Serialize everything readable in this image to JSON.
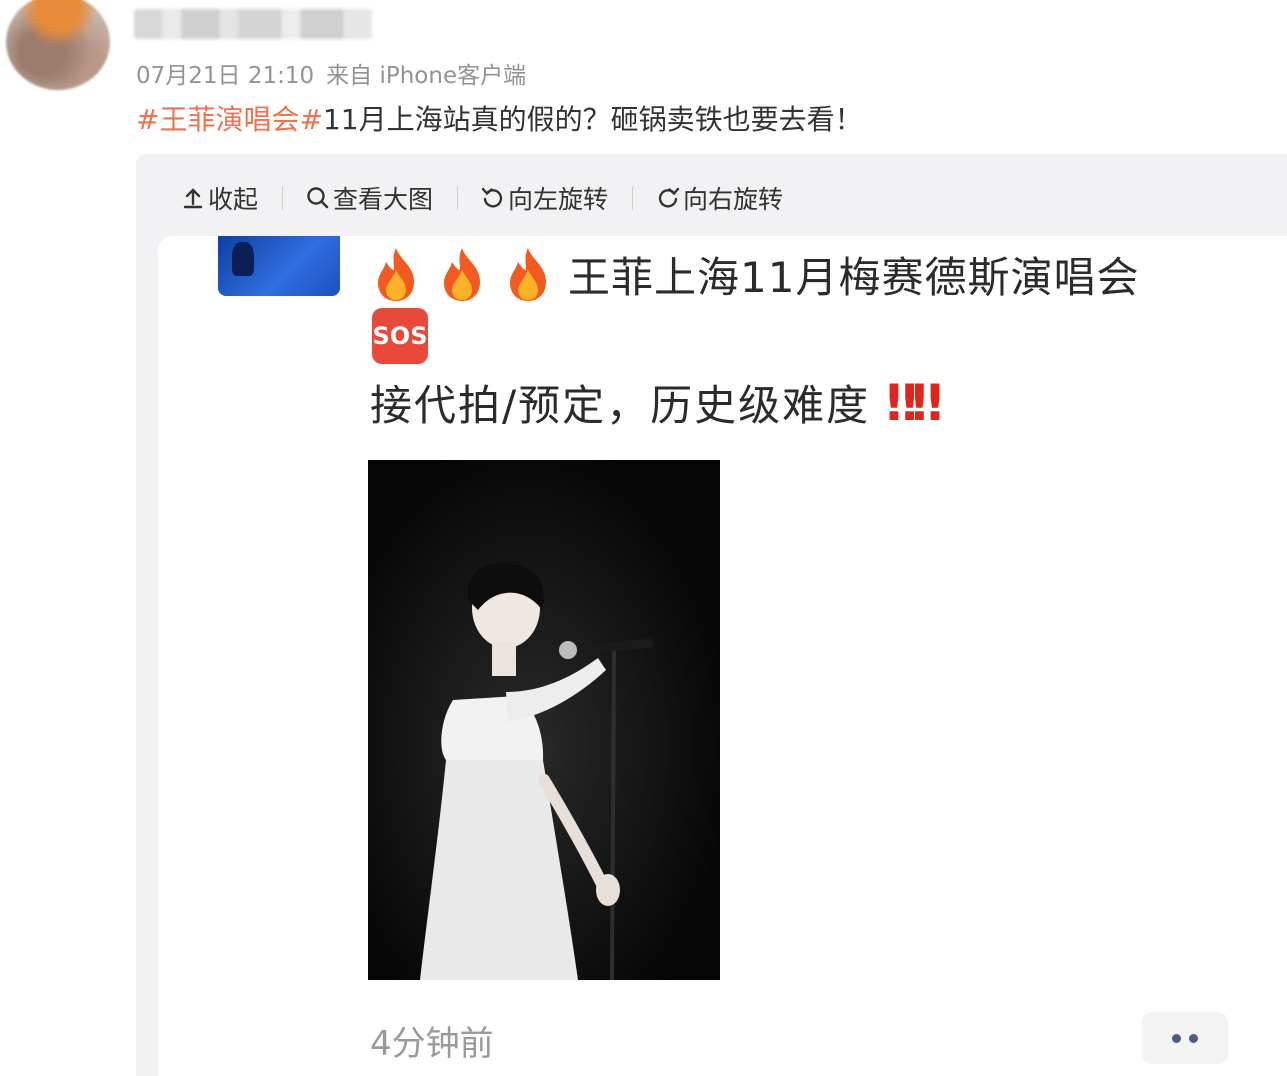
{
  "post": {
    "username_blurred": "",
    "timestamp": "07月21日 21:10",
    "source": "来自 iPhone客户端",
    "topic": "#王菲演唱会#",
    "text": "11月上海站真的假的？砸锅卖铁也要去看！"
  },
  "toolbar": {
    "collapse_label": "收起",
    "view_large_label": "查看大图",
    "rotate_left_label": "向左旋转",
    "rotate_right_label": "向右旋转",
    "icons": [
      "collapse-icon",
      "search-icon",
      "rotate-left-icon",
      "rotate-right-icon"
    ]
  },
  "image": {
    "headline": "王菲上海11月梅赛德斯演唱会",
    "sos_badge": "SOS",
    "line2": "接代拍/预定，历史级难度",
    "exclaim": "‼‼",
    "time_ago": "4分钟前",
    "emojis": [
      "fire",
      "fire",
      "fire",
      "sos",
      "double-exclamation"
    ]
  },
  "colors": {
    "topic": "#eb7350",
    "meta": "#939393",
    "card_bg": "#f2f2f5",
    "sos_bg": "#e8493a",
    "exclaim": "#e0261c"
  }
}
